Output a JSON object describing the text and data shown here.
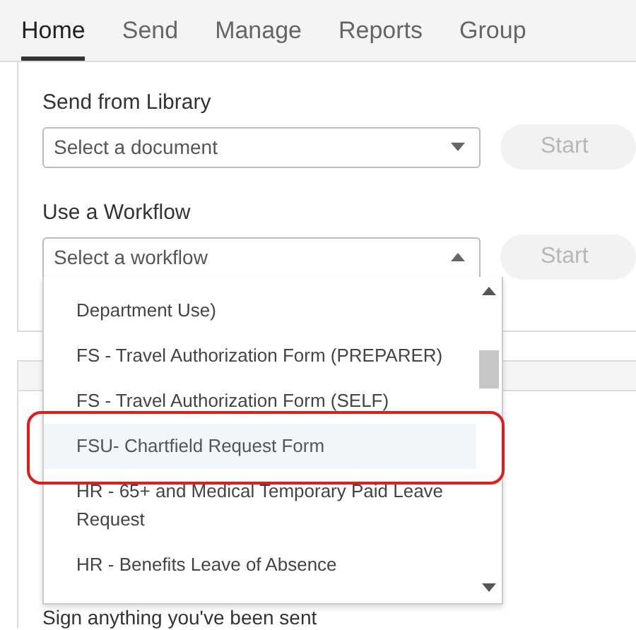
{
  "tabs": [
    {
      "label": "Home",
      "selected": true
    },
    {
      "label": "Send",
      "selected": false
    },
    {
      "label": "Manage",
      "selected": false
    },
    {
      "label": "Reports",
      "selected": false
    },
    {
      "label": "Group",
      "selected": false
    }
  ],
  "send_from_library": {
    "label": "Send from Library",
    "placeholder": "Select a document",
    "expanded": false,
    "button": {
      "label": "Start",
      "disabled": true
    }
  },
  "workflow": {
    "label": "Use a Workflow",
    "placeholder": "Select a workflow",
    "expanded": true,
    "button": {
      "label": "Start",
      "disabled": true
    },
    "options": [
      {
        "label": "Department Use)",
        "selected": false,
        "circled": false
      },
      {
        "label": "FS - Travel Authorization Form (PREPARER)",
        "selected": false,
        "circled": false
      },
      {
        "label": "FS - Travel Authorization Form (SELF)",
        "selected": false,
        "circled": false
      },
      {
        "label": "FSU- Chartfield Request Form",
        "selected": true,
        "circled": true
      },
      {
        "label": "HR - 65+ and Medical Temporary Paid Leave Request",
        "selected": false,
        "circled": false
      },
      {
        "label": "HR - Benefits Leave of Absence",
        "selected": false,
        "circled": false
      }
    ]
  },
  "sign_section": {
    "text": "Sign anything you've been sent"
  }
}
